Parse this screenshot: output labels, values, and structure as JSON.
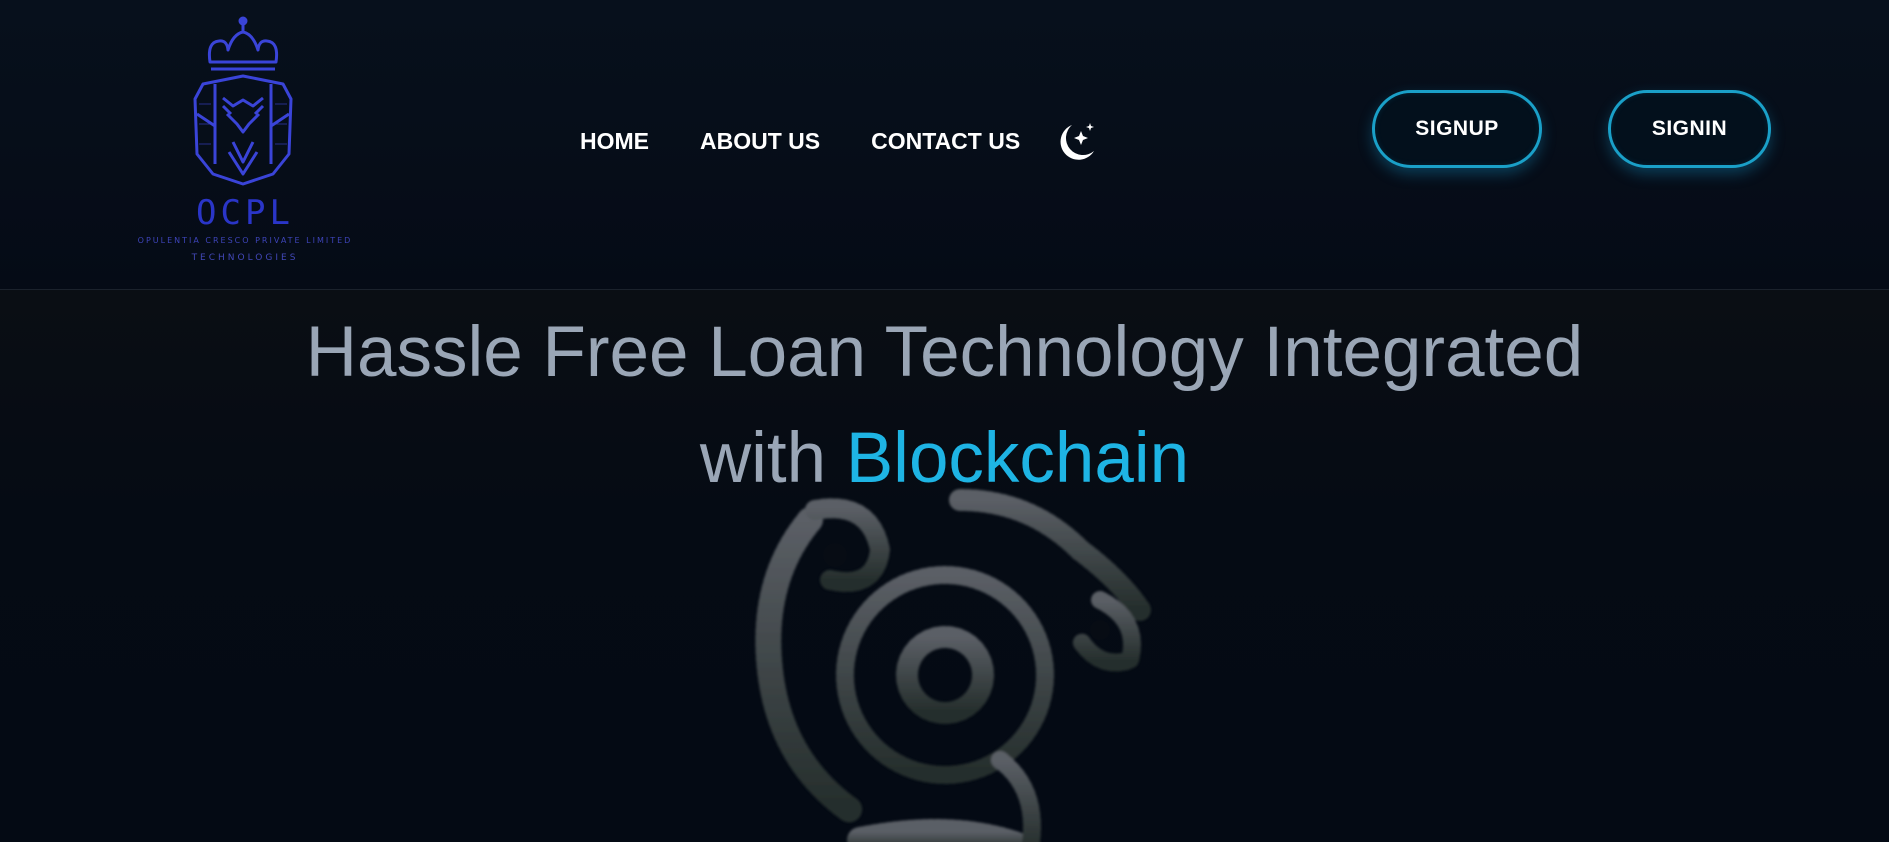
{
  "logo": {
    "abbr": "OCPL",
    "company": "OPULENTIA CRESCO PRIVATE LIMITED",
    "tagline": "TECHNOLOGIES",
    "color": "#3a44d8"
  },
  "nav": {
    "items": [
      {
        "label": "HOME"
      },
      {
        "label": "ABOUT US"
      },
      {
        "label": "CONTACT US"
      }
    ],
    "theme_toggle_icon": "moon-stars-icon"
  },
  "auth": {
    "signup_label": "SIGNUP",
    "signin_label": "SIGNIN",
    "border_color": "#1aa0c8"
  },
  "hero": {
    "title_line1": "Hassle Free Loan Technology Integrated",
    "title_with": "with",
    "title_accent": "Blockchain",
    "accent_color": "#1eb4e4",
    "art_icon": "blockchain-particle-icon"
  },
  "colors": {
    "background": "#050a14",
    "text_muted": "#9aa6b6"
  }
}
